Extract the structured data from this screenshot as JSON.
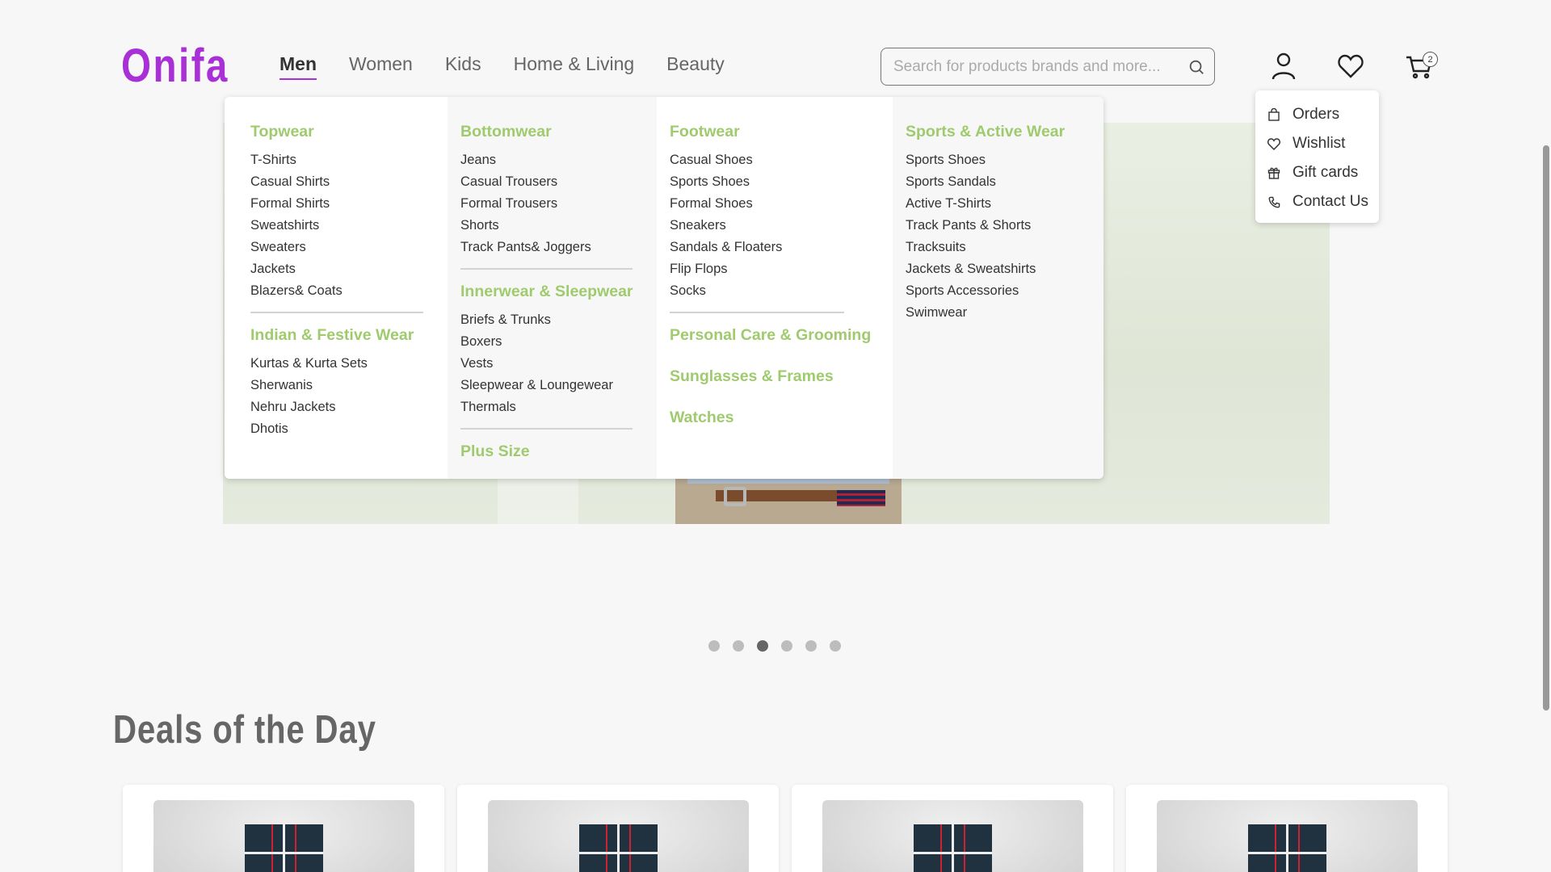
{
  "brand": {
    "logo": "Onifa",
    "accent_color": "#a92fd6",
    "category_color": "#9fcb6e"
  },
  "nav": {
    "items": [
      {
        "label": "Men",
        "active": true
      },
      {
        "label": "Women",
        "active": false
      },
      {
        "label": "Kids",
        "active": false
      },
      {
        "label": "Home & Living",
        "active": false
      },
      {
        "label": "Beauty",
        "active": false
      }
    ]
  },
  "search": {
    "placeholder": "Search for products brands and more...",
    "value": ""
  },
  "header_icons": {
    "user": "user-icon",
    "wishlist": "heart-icon",
    "cart": "cart-icon",
    "cart_count": "2"
  },
  "account_menu": {
    "items": [
      {
        "label": "Orders",
        "icon": "bag-icon"
      },
      {
        "label": "Wishlist",
        "icon": "heart-icon"
      },
      {
        "label": "Gift cards",
        "icon": "gift-icon"
      },
      {
        "label": "Contact Us",
        "icon": "phone-icon"
      }
    ]
  },
  "mega_menu": {
    "col1": {
      "topwear": {
        "title": "Topwear",
        "items": [
          "T-Shirts",
          "Casual Shirts",
          "Formal Shirts",
          "Sweatshirts",
          "Sweaters",
          "Jackets",
          "Blazers& Coats"
        ]
      },
      "indian": {
        "title": "Indian & Festive Wear",
        "items": [
          "Kurtas & Kurta Sets",
          "Sherwanis",
          "Nehru Jackets",
          "Dhotis"
        ]
      }
    },
    "col2": {
      "bottomwear": {
        "title": "Bottomwear",
        "items": [
          "Jeans",
          "Casual Trousers",
          "Formal Trousers",
          "Shorts",
          "Track Pants& Joggers"
        ]
      },
      "innerwear": {
        "title": "Innerwear & Sleepwear",
        "items": [
          "Briefs & Trunks",
          "Boxers",
          "Vests",
          "Sleepwear & Loungewear",
          "Thermals"
        ]
      },
      "plus": {
        "title": "Plus Size"
      }
    },
    "col3": {
      "footwear": {
        "title": "Footwear",
        "items": [
          "Casual Shoes",
          "Sports Shoes",
          "Formal Shoes",
          "Sneakers",
          "Sandals & Floaters",
          "Flip Flops",
          "Socks"
        ]
      },
      "personal_care": {
        "title": "Personal Care & Grooming"
      },
      "sunglasses": {
        "title": "Sunglasses & Frames"
      },
      "watches": {
        "title": "Watches"
      }
    },
    "col4": {
      "sports": {
        "title": "Sports & Active Wear",
        "items": [
          "Sports Shoes",
          "Sports Sandals",
          "Active T-Shirts",
          "Track Pants & Shorts",
          "Tracksuits",
          "Jackets & Sweatshirts",
          "Sports Accessories",
          "Swimwear"
        ]
      }
    }
  },
  "carousel": {
    "total": 6,
    "active_index": 3
  },
  "deals": {
    "title": "Deals of the Day",
    "card_count": 4
  }
}
